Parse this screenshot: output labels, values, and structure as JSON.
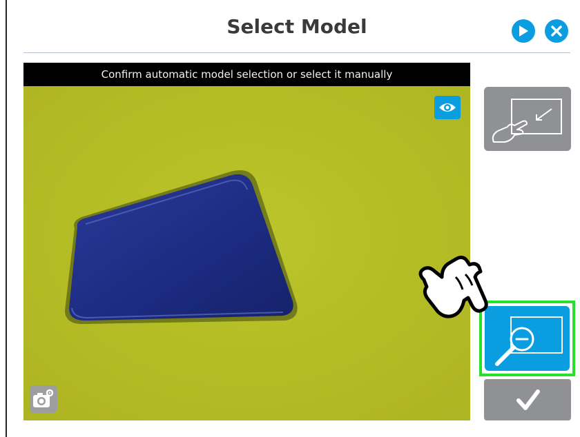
{
  "header": {
    "title": "Select Model"
  },
  "viewer": {
    "caption": "Confirm automatic model selection or select it manually"
  },
  "icons": {
    "play": "play-icon",
    "close": "close-icon",
    "eye": "eye-icon",
    "camera_settings": "camera-settings-icon",
    "select_area": "select-area-icon",
    "zoom_out": "zoom-out-icon",
    "confirm": "checkmark-icon",
    "pointer": "pointing-hand-icon"
  },
  "colors": {
    "accent": "#0a9de0",
    "disabled": "#8f9194",
    "highlight": "#27e02a",
    "background_surface": "#b9c228",
    "part": "#1f2f86"
  }
}
